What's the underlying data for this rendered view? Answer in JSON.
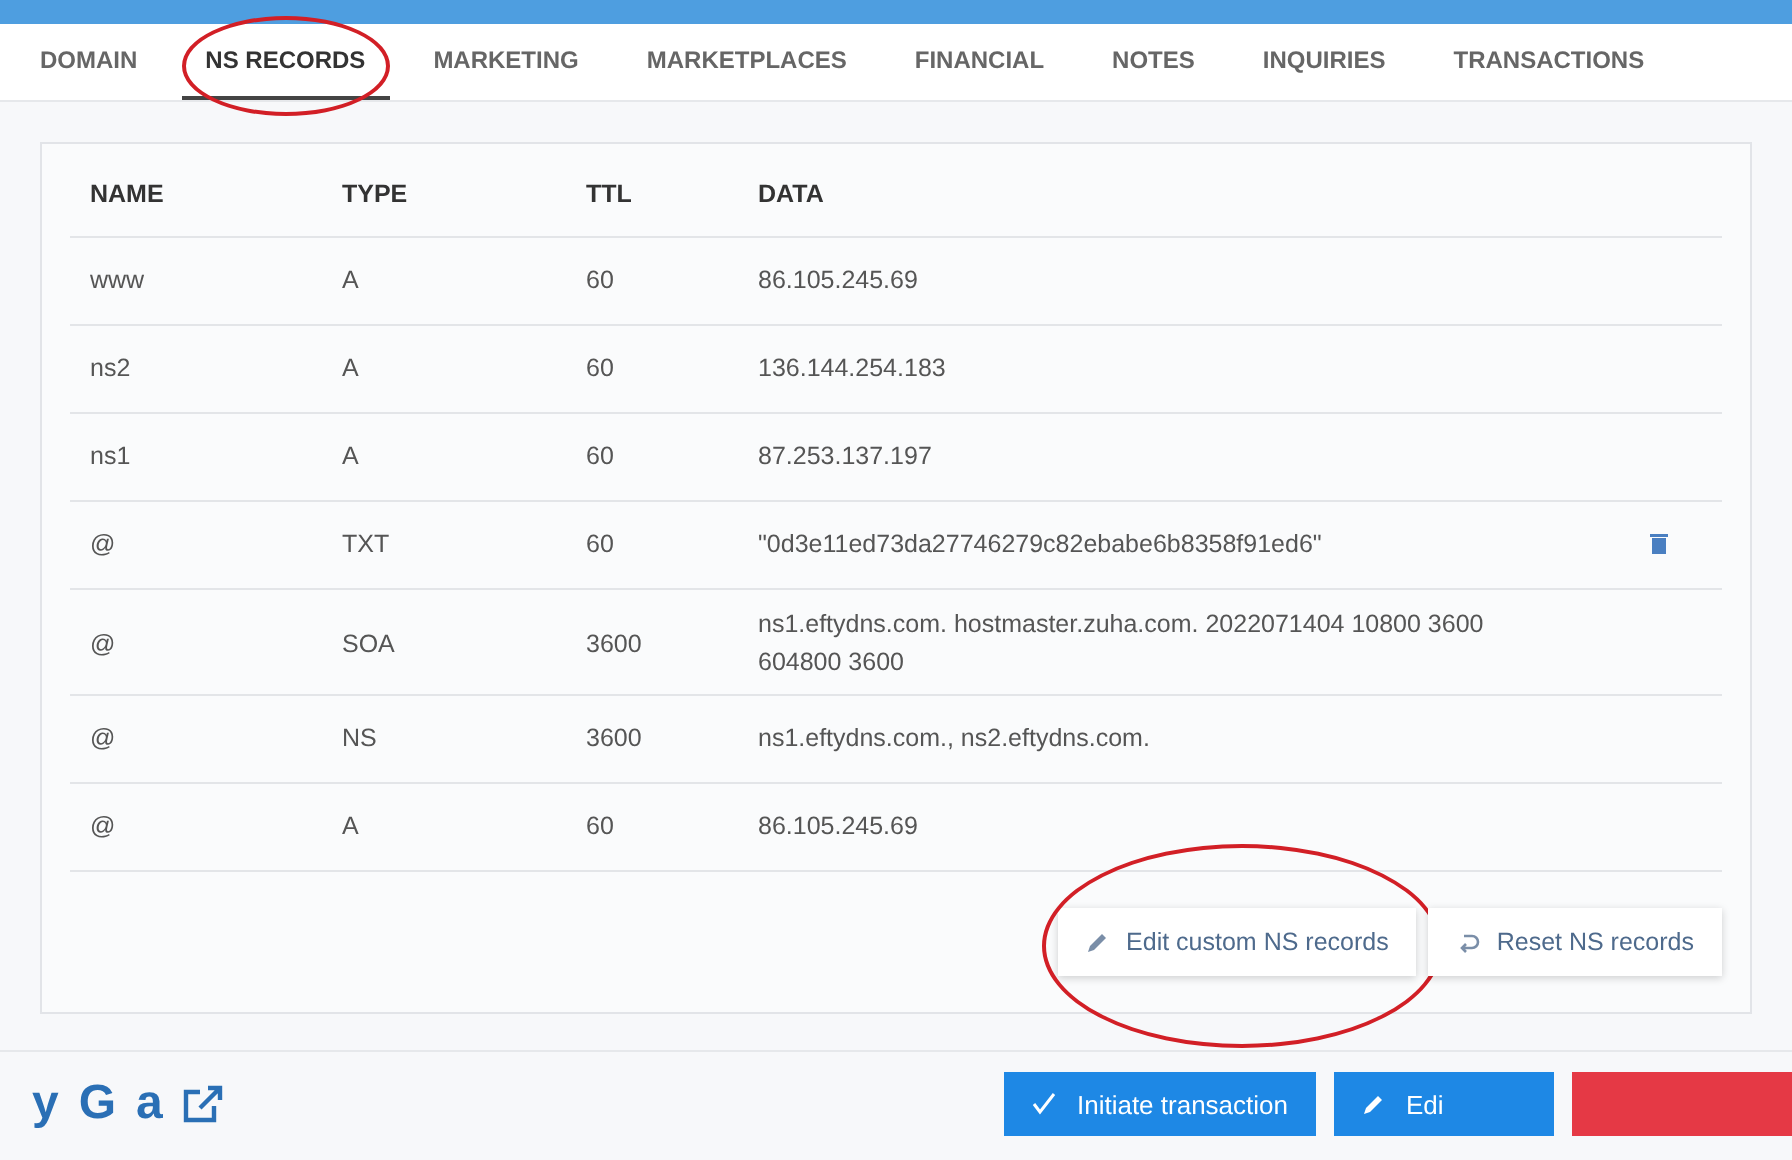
{
  "tabs": [
    {
      "label": "DOMAIN",
      "selected": false,
      "circled": false
    },
    {
      "label": "NS RECORDS",
      "selected": true,
      "circled": true
    },
    {
      "label": "MARKETING",
      "selected": false,
      "circled": false
    },
    {
      "label": "MARKETPLACES",
      "selected": false,
      "circled": false
    },
    {
      "label": "FINANCIAL",
      "selected": false,
      "circled": false
    },
    {
      "label": "NOTES",
      "selected": false,
      "circled": false
    },
    {
      "label": "INQUIRIES",
      "selected": false,
      "circled": false
    },
    {
      "label": "TRANSACTIONS",
      "selected": false,
      "circled": false
    }
  ],
  "table": {
    "columns": [
      "NAME",
      "TYPE",
      "TTL",
      "DATA"
    ],
    "rows": [
      {
        "cells": [
          "www",
          "A",
          "60",
          "86.105.245.69"
        ],
        "deletable": false
      },
      {
        "cells": [
          "ns2",
          "A",
          "60",
          "136.144.254.183"
        ],
        "deletable": false
      },
      {
        "cells": [
          "ns1",
          "A",
          "60",
          "87.253.137.197"
        ],
        "deletable": false
      },
      {
        "cells": [
          "@",
          "TXT",
          "60",
          "\"0d3e11ed73da27746279c82ebabe6b8358f91ed6\""
        ],
        "deletable": true
      },
      {
        "cells": [
          "@",
          "SOA",
          "3600",
          "ns1.eftydns.com. hostmaster.zuha.com. 2022071404 10800 3600 604800 3600"
        ],
        "deletable": false
      },
      {
        "cells": [
          "@",
          "NS",
          "3600",
          "ns1.eftydns.com., ns2.eftydns.com."
        ],
        "deletable": false
      },
      {
        "cells": [
          "@",
          "A",
          "60",
          "86.105.245.69"
        ],
        "deletable": false
      }
    ]
  },
  "actions": [
    {
      "label": "Edit custom NS records",
      "kind": "edit",
      "circled": true
    },
    {
      "label": "Reset NS records",
      "kind": "reset",
      "circled": false
    }
  ],
  "footer": {
    "logos": [
      "y",
      "G",
      "a"
    ],
    "buttons": [
      {
        "label": "Initiate transaction",
        "kind": "check",
        "color": "#1e88e5"
      },
      {
        "label": "Edi",
        "kind": "edit",
        "color": "#1e88e5"
      },
      {
        "kind": "plain",
        "color": "#e53945"
      }
    ]
  }
}
